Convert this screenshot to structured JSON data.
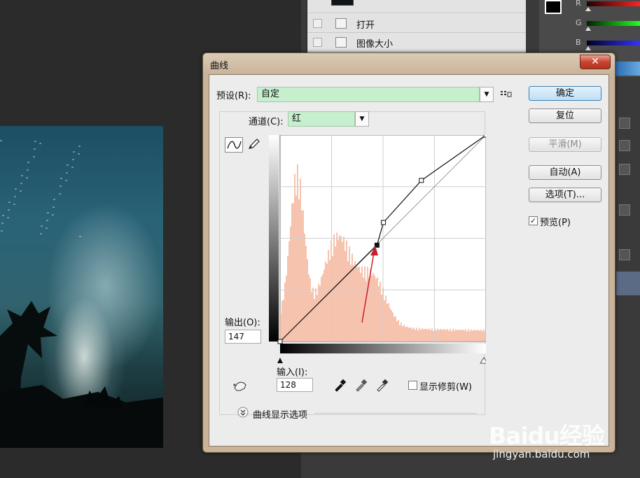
{
  "history_panel": {
    "items": [
      {
        "label": "打开"
      },
      {
        "label": "图像大小"
      }
    ]
  },
  "color_panel": {
    "channels": [
      "R",
      "G",
      "B"
    ]
  },
  "dialog": {
    "title": "曲线",
    "close_glyph": "✕",
    "preset_label": "预设(R):",
    "preset_value": "自定",
    "preset_menu_icon": "list-options-icon",
    "channel_label": "通道(C):",
    "channel_value": "红",
    "output_label": "输出(O):",
    "output_value": "147",
    "input_label": "输入(I):",
    "input_value": "128",
    "show_clipping_label": "显示修剪(W)",
    "show_clipping_checked": false,
    "display_options_label": "曲线显示选项",
    "buttons": {
      "ok": "确定",
      "reset": "复位",
      "smooth": "平滑(M)",
      "auto": "自动(A)",
      "options": "选项(T)..."
    },
    "preview_label": "预览(P)",
    "preview_checked": true,
    "icons": {
      "curve_mode": "curve-mode-icon",
      "pencil": "pencil-icon",
      "target_adjust": "hand-target-icon",
      "eyedroppers": [
        "black-eyedropper-icon",
        "gray-eyedropper-icon",
        "white-eyedropper-icon"
      ],
      "expand": "chevron-down-circle-icon"
    }
  },
  "curve": {
    "points": [
      [
        0,
        0
      ],
      [
        120,
        119
      ],
      [
        128,
        147
      ],
      [
        175,
        199
      ],
      [
        255,
        255
      ]
    ],
    "selected_point": [
      120,
      119
    ],
    "channel_color": "#f4b8a0",
    "annotation_color": "#c8202a"
  },
  "watermark": {
    "logo_text": "Baidu经验",
    "url": "jingyan.baidu.com"
  }
}
